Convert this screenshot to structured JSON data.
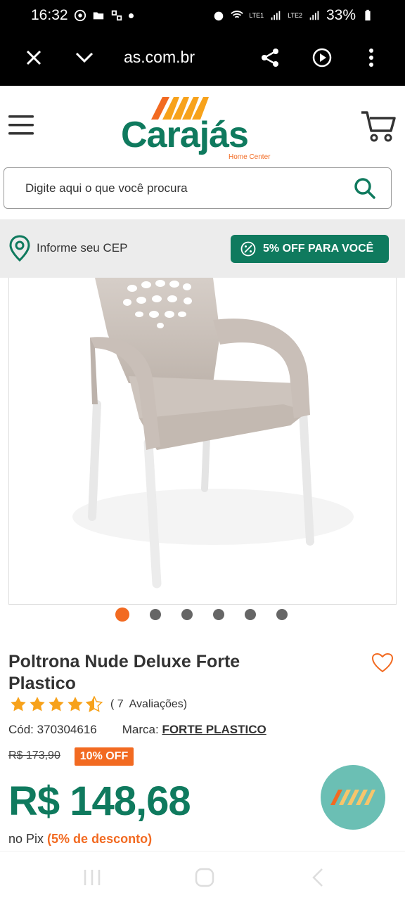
{
  "status": {
    "time": "16:32",
    "battery": "33%",
    "sim1": "LTE1",
    "sim2": "LTE2"
  },
  "browser": {
    "url": "as.com.br",
    "close_icon": "close-icon",
    "menu_icon": "more-vert-icon"
  },
  "header": {
    "brand_name": "Carajás",
    "brand_sub": "Home Center"
  },
  "search": {
    "placeholder": "Digite aqui o que você procura"
  },
  "cep": {
    "label": "Informe seu CEP"
  },
  "promo": {
    "label": "5% OFF PARA VOCÊ"
  },
  "carousel": {
    "count": 6,
    "active_index": 0
  },
  "product": {
    "title": "Poltrona Nude Deluxe Forte Plastico",
    "rating_value": 4.5,
    "rating_count": "( 7",
    "rating_label": "Avaliações)",
    "code_label": "Cód:",
    "code": "370304616",
    "brand_label": "Marca:",
    "brand": "FORTE PLASTICO",
    "old_price": "R$ 173,90",
    "discount": "10% OFF",
    "price": "R$ 148,68",
    "pix_prefix": "no Pix",
    "pix_discount": "(5% de desconto)"
  },
  "colors": {
    "brand_green": "#0f7a5e",
    "brand_orange": "#f26a21",
    "fab_bg": "#6bbfb4"
  }
}
